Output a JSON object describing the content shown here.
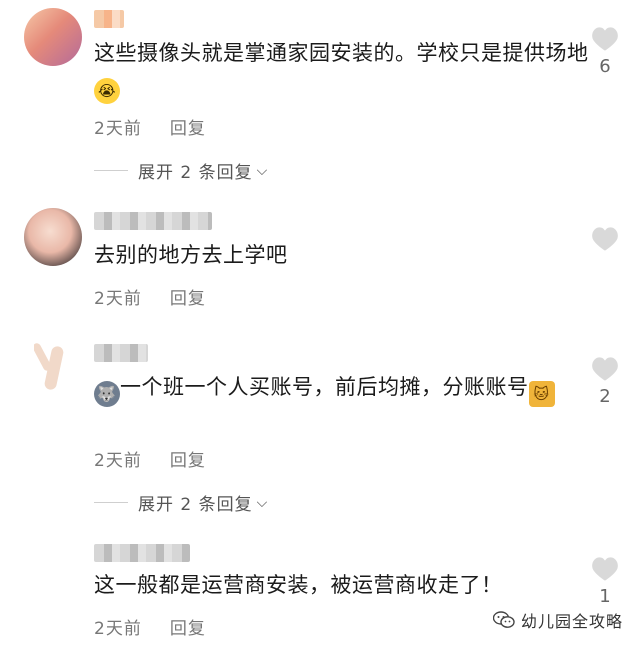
{
  "comments": [
    {
      "text_main": "这些摄像头就是掌通家园安装的。学校只是提供场地",
      "emoji": "😭",
      "time": "2天前",
      "reply_label": "回复",
      "expand_label": "展开 2 条回复",
      "likes": "6"
    },
    {
      "text_main": "去别的地方去上学吧",
      "time": "2天前",
      "reply_label": "回复",
      "likes": ""
    },
    {
      "emoji_lead": "🐺",
      "text_main": "一个班一个人买账号，前后均摊，分账账号",
      "emoji_tail": "🐱",
      "time": "2天前",
      "reply_label": "回复",
      "expand_label": "展开 2 条回复",
      "likes": "2"
    },
    {
      "text_main": "这一般都是运营商安装，被运营商收走了！",
      "time": "2天前",
      "reply_label": "回复",
      "likes": "1"
    }
  ],
  "watermark": {
    "text": "幼儿园全攻略",
    "icon": "wechat-icon"
  },
  "colors": {
    "text": "#1b1b1b",
    "meta": "#777777",
    "heart": "#d9d9d9"
  }
}
